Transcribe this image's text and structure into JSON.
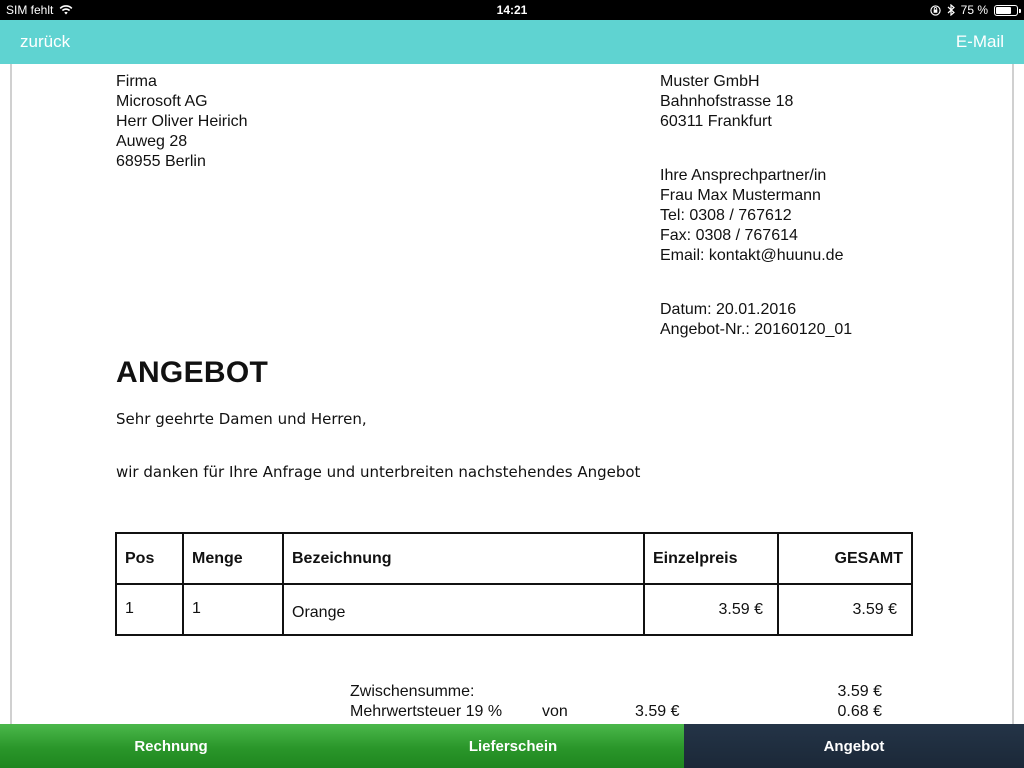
{
  "status_bar": {
    "carrier": "SIM fehlt",
    "time": "14:21",
    "battery_text": "75 %",
    "battery_level": 0.75
  },
  "nav": {
    "back_label": "zurück",
    "email_label": "E-Mail",
    "accent_color": "#5fd3d1"
  },
  "document": {
    "recipient": [
      "Firma",
      "Microsoft AG",
      "Herr Oliver Heirich",
      "Auweg 28",
      "68955 Berlin"
    ],
    "sender": [
      "Muster GmbH",
      "Bahnhofstrasse 18",
      "60311 Frankfurt"
    ],
    "contact": [
      "Ihre Ansprechpartner/in",
      "Frau Max Mustermann",
      "Tel: 0308 / 767612",
      "Fax: 0308 / 767614",
      "Email: kontakt@huunu.de"
    ],
    "date_line": "Datum: 20.01.2016",
    "offer_no_line": "Angebot-Nr.: 20160120_01",
    "title": "ANGEBOT",
    "salutation": "Sehr geehrte Damen und Herren,",
    "intro": "wir danken für Ihre Anfrage und unterbreiten nachstehendes Angebot",
    "table": {
      "headers": [
        "Pos",
        "Menge",
        "Bezeichnung",
        "Einzelpreis",
        "GESAMT"
      ],
      "rows": [
        {
          "pos": "1",
          "qty": "1",
          "desc": "Orange",
          "unit_price": "3.59 €",
          "total": "3.59 €"
        }
      ]
    },
    "totals": {
      "subtotal_label": "Zwischensumme:",
      "subtotal_value": "3.59 €",
      "vat_label": "Mehrwertsteuer 19 %",
      "vat_of": "von",
      "vat_base": "3.59 €",
      "vat_value": "0.68 €"
    }
  },
  "tabs": {
    "rechnung": "Rechnung",
    "lieferschein": "Lieferschein",
    "angebot": "Angebot",
    "active": "angebot",
    "colors": {
      "inactive": "#2a962a",
      "active": "#1b2838"
    }
  }
}
